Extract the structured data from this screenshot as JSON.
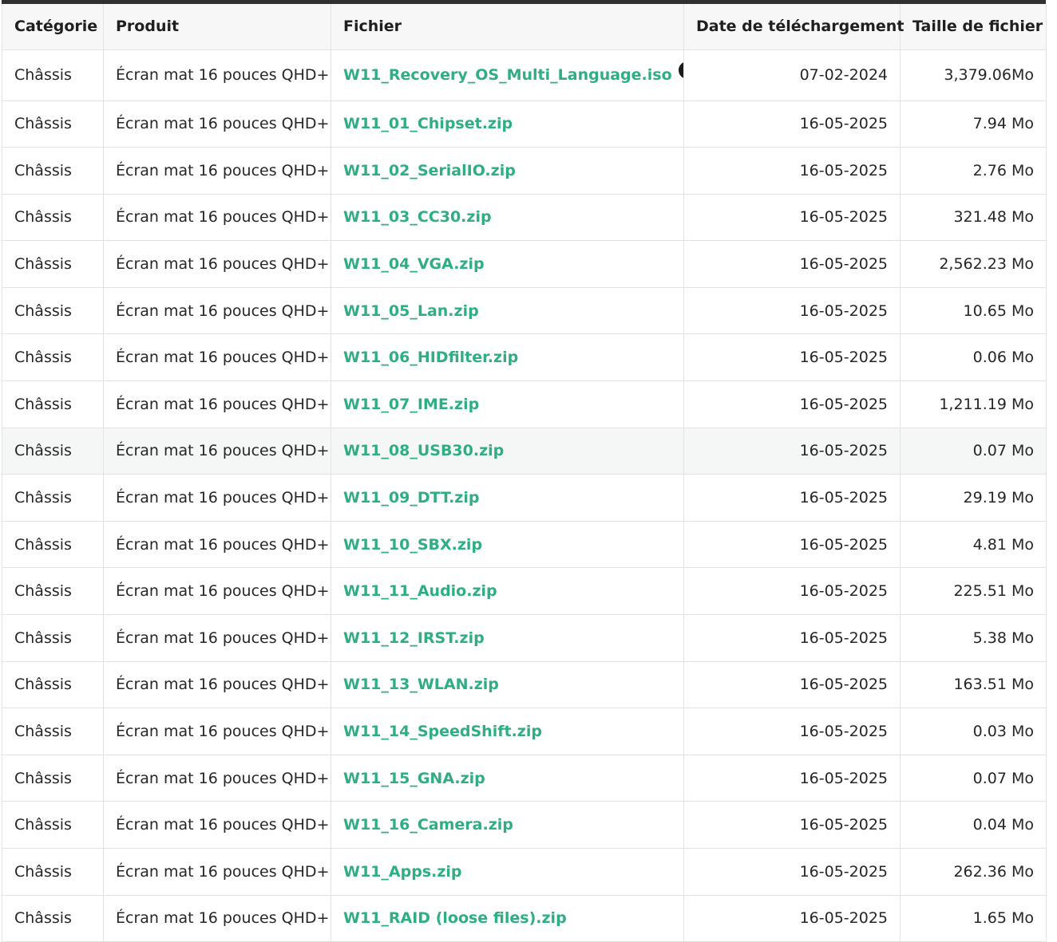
{
  "columns": {
    "category": "Catégorie",
    "product": "Produit",
    "file": "Fichier",
    "date": "Date de téléchargement",
    "size": "Taille de fichier"
  },
  "rows": [
    {
      "category": "Châssis",
      "product": "Écran mat 16 pouces QHD+",
      "file": "W11_Recovery_OS_Multi_Language.iso",
      "help": "?",
      "date": "07-02-2024",
      "size": "3,379.06Mo"
    },
    {
      "category": "Châssis",
      "product": "Écran mat 16 pouces QHD+",
      "file": "W11_01_Chipset.zip",
      "date": "16-05-2025",
      "size": "7.94 Mo"
    },
    {
      "category": "Châssis",
      "product": "Écran mat 16 pouces QHD+",
      "file": "W11_02_SerialIO.zip",
      "date": "16-05-2025",
      "size": "2.76 Mo"
    },
    {
      "category": "Châssis",
      "product": "Écran mat 16 pouces QHD+",
      "file": "W11_03_CC30.zip",
      "date": "16-05-2025",
      "size": "321.48 Mo"
    },
    {
      "category": "Châssis",
      "product": "Écran mat 16 pouces QHD+",
      "file": "W11_04_VGA.zip",
      "date": "16-05-2025",
      "size": "2,562.23 Mo"
    },
    {
      "category": "Châssis",
      "product": "Écran mat 16 pouces QHD+",
      "file": "W11_05_Lan.zip",
      "date": "16-05-2025",
      "size": "10.65 Mo"
    },
    {
      "category": "Châssis",
      "product": "Écran mat 16 pouces QHD+",
      "file": "W11_06_HIDfilter.zip",
      "date": "16-05-2025",
      "size": "0.06 Mo"
    },
    {
      "category": "Châssis",
      "product": "Écran mat 16 pouces QHD+",
      "file": "W11_07_IME.zip",
      "date": "16-05-2025",
      "size": "1,211.19 Mo"
    },
    {
      "category": "Châssis",
      "product": "Écran mat 16 pouces QHD+",
      "file": "W11_08_USB30.zip",
      "date": "16-05-2025",
      "size": "0.07 Mo"
    },
    {
      "category": "Châssis",
      "product": "Écran mat 16 pouces QHD+",
      "file": "W11_09_DTT.zip",
      "date": "16-05-2025",
      "size": "29.19 Mo"
    },
    {
      "category": "Châssis",
      "product": "Écran mat 16 pouces QHD+",
      "file": "W11_10_SBX.zip",
      "date": "16-05-2025",
      "size": "4.81 Mo"
    },
    {
      "category": "Châssis",
      "product": "Écran mat 16 pouces QHD+",
      "file": "W11_11_Audio.zip",
      "date": "16-05-2025",
      "size": "225.51 Mo"
    },
    {
      "category": "Châssis",
      "product": "Écran mat 16 pouces QHD+",
      "file": "W11_12_IRST.zip",
      "date": "16-05-2025",
      "size": "5.38 Mo"
    },
    {
      "category": "Châssis",
      "product": "Écran mat 16 pouces QHD+",
      "file": "W11_13_WLAN.zip",
      "date": "16-05-2025",
      "size": "163.51 Mo"
    },
    {
      "category": "Châssis",
      "product": "Écran mat 16 pouces QHD+",
      "file": "W11_14_SpeedShift.zip",
      "date": "16-05-2025",
      "size": "0.03 Mo"
    },
    {
      "category": "Châssis",
      "product": "Écran mat 16 pouces QHD+",
      "file": "W11_15_GNA.zip",
      "date": "16-05-2025",
      "size": "0.07 Mo"
    },
    {
      "category": "Châssis",
      "product": "Écran mat 16 pouces QHD+",
      "file": "W11_16_Camera.zip",
      "date": "16-05-2025",
      "size": "0.04 Mo"
    },
    {
      "category": "Châssis",
      "product": "Écran mat 16 pouces QHD+",
      "file": "W11_Apps.zip",
      "date": "16-05-2025",
      "size": "262.36 Mo"
    },
    {
      "category": "Châssis",
      "product": "Écran mat 16 pouces QHD+",
      "file": "W11_RAID (loose files).zip",
      "date": "16-05-2025",
      "size": "1.65 Mo"
    }
  ],
  "highlighted_row": 8,
  "colors": {
    "link": "#2fae82",
    "header_bg": "#f7f7f7",
    "highlight_bg": "#f5f7f6",
    "top_border": "#2f3032"
  },
  "icons": {
    "help": "question-circle-icon"
  }
}
